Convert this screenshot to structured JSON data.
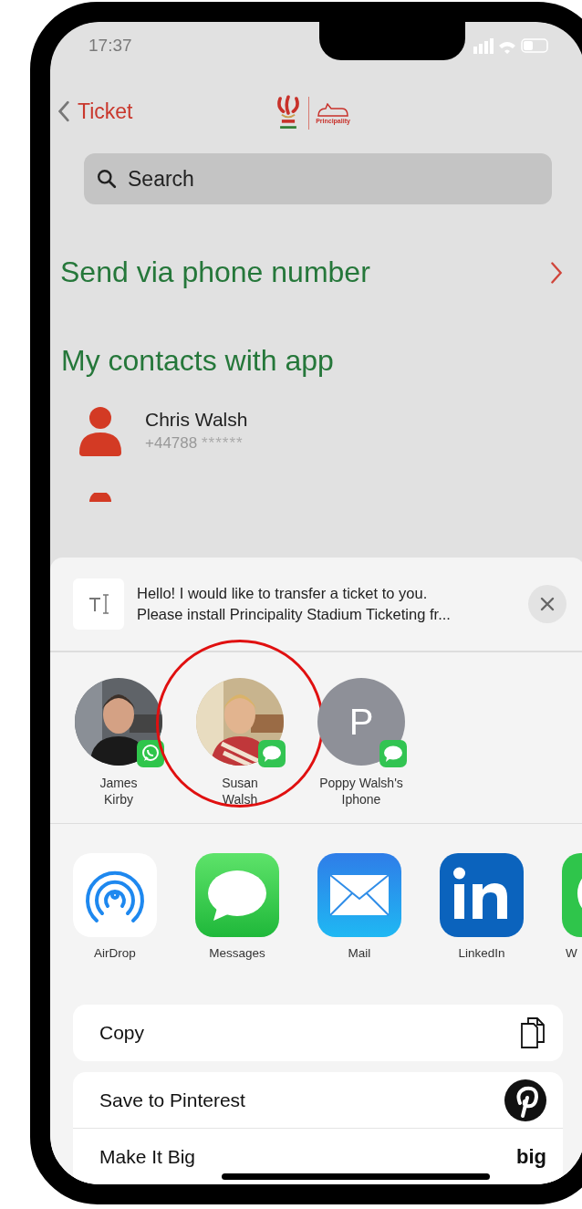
{
  "status_bar": {
    "time": "17:37"
  },
  "header": {
    "back_label": "Ticket",
    "logo_text": "Principality"
  },
  "search": {
    "placeholder": "Search"
  },
  "send_via_phone": {
    "label": "Send via phone number"
  },
  "contacts_section": {
    "title": "My contacts with app",
    "contacts": [
      {
        "name": "Chris Walsh",
        "phone": "+44788",
        "masked": "******"
      }
    ]
  },
  "share_sheet": {
    "message": "Hello! I would like to transfer a ticket to you.\nPlease install Principality Stadium Ticketing fr...",
    "people": [
      {
        "name": "James\nKirby",
        "badge": {
          "kind": "whatsapp"
        },
        "highlighted": false
      },
      {
        "name": "Susan\nWalsh",
        "badge": {
          "kind": "messages"
        },
        "highlighted": true
      },
      {
        "name": "Poppy Walsh's\nIphone",
        "avatar": {
          "kind": "initial",
          "initial": "P"
        },
        "badge": {
          "kind": "messages"
        },
        "highlighted": false
      }
    ],
    "apps": [
      {
        "kind": "airdrop",
        "label": "AirDrop"
      },
      {
        "kind": "messages",
        "label": "Messages"
      },
      {
        "kind": "mail",
        "label": "Mail"
      },
      {
        "kind": "linkedin",
        "label": "LinkedIn"
      },
      {
        "kind": "whatsapp",
        "label": "W"
      }
    ],
    "action_groups": [
      [
        {
          "kind": "copy",
          "label": "Copy"
        }
      ],
      [
        {
          "kind": "pinterest",
          "label": "Save to Pinterest"
        },
        {
          "kind": "bigtext",
          "label": "Make It Big",
          "icon_text": "big"
        }
      ]
    ]
  }
}
